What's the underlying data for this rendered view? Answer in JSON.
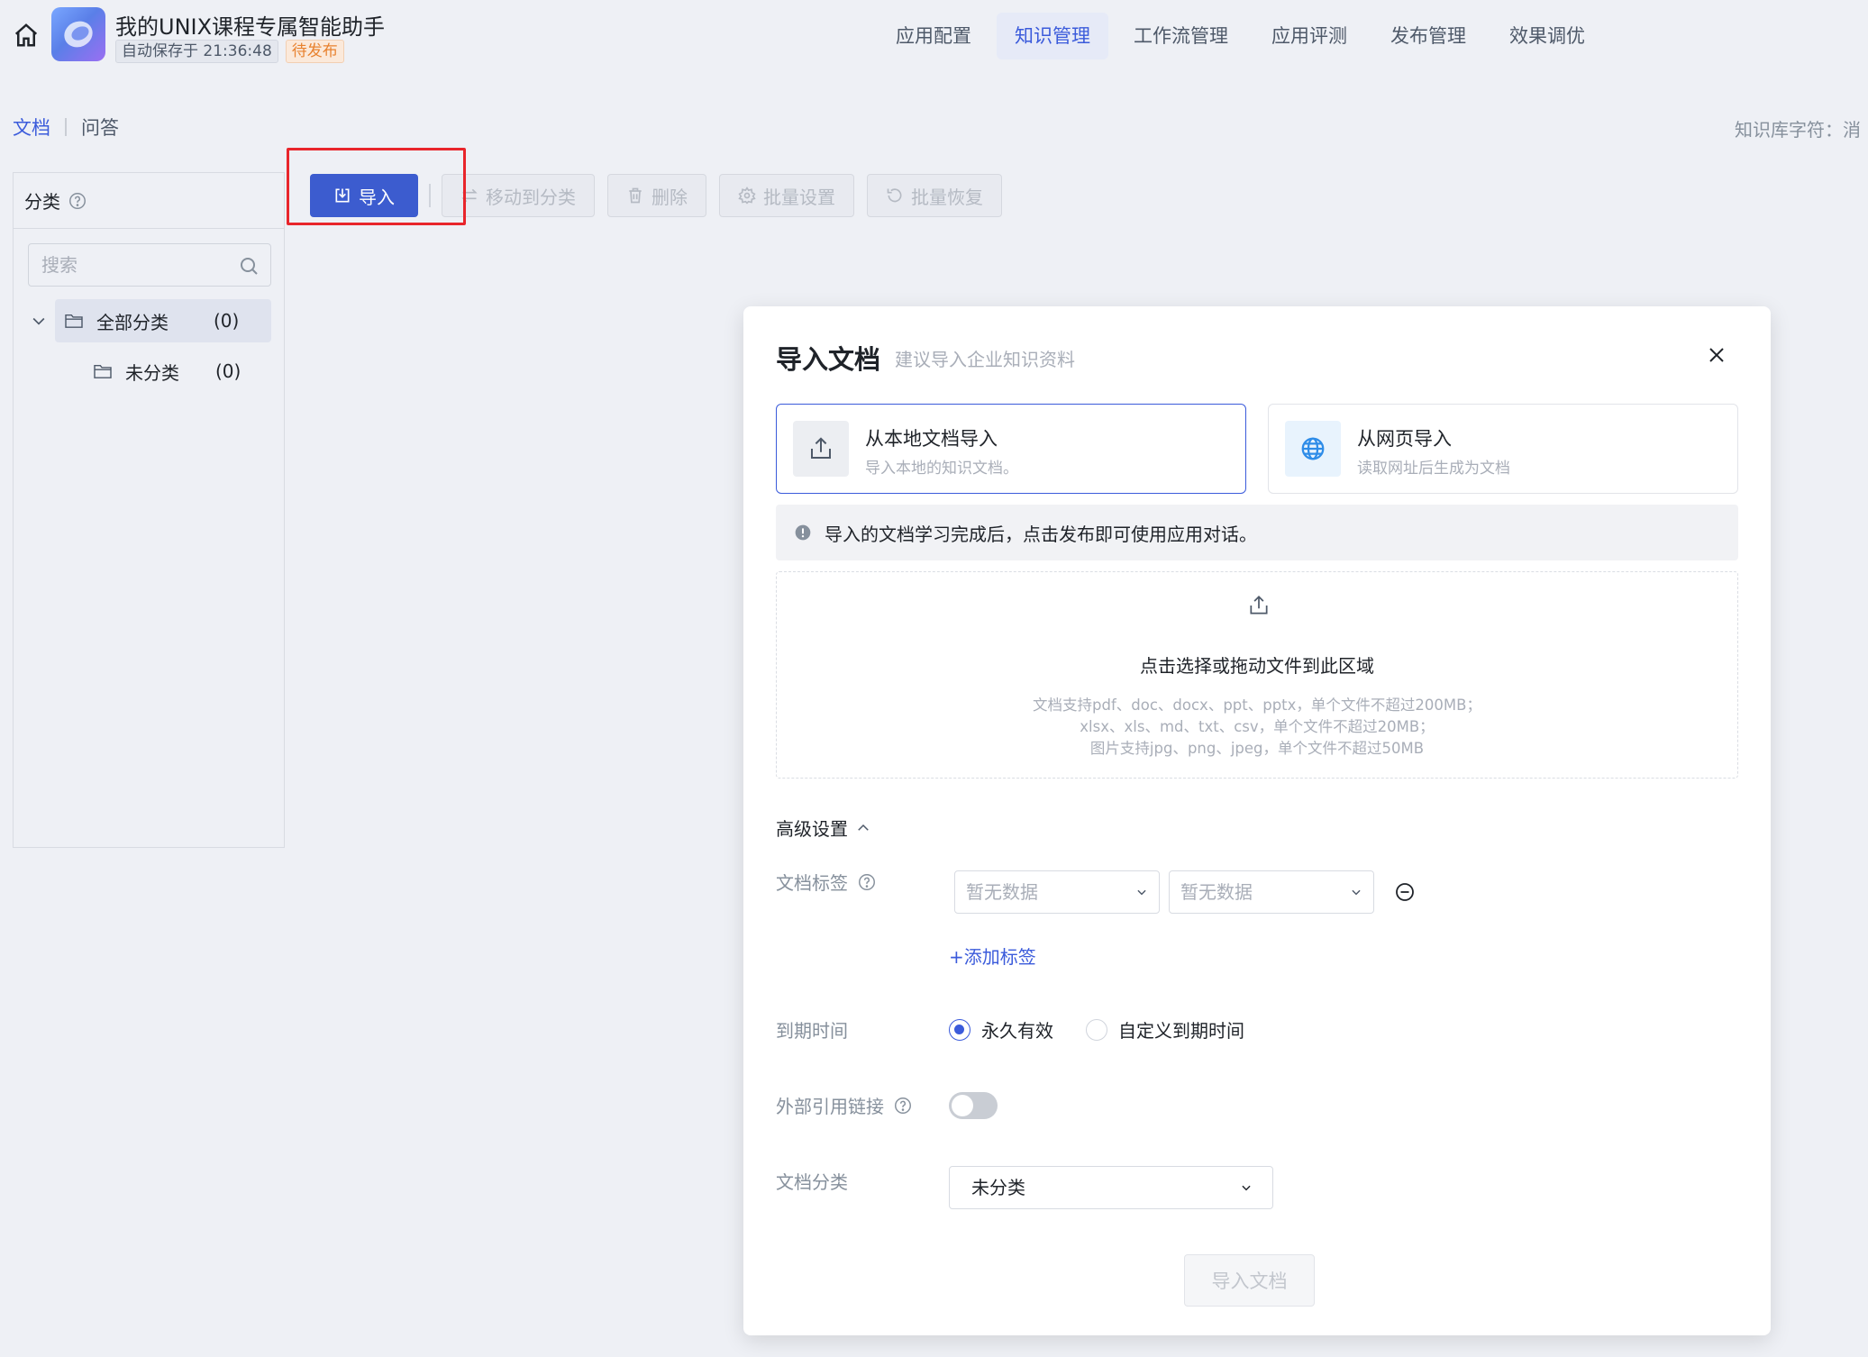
{
  "header": {
    "app_title": "我的UNIX课程专属智能助手",
    "autosave": "自动保存于 21:36:48",
    "status_badge": "待发布",
    "nav": [
      "应用配置",
      "知识管理",
      "工作流管理",
      "应用评测",
      "发布管理",
      "效果调优"
    ],
    "active_nav": "知识管理"
  },
  "subnav": {
    "tab_documents": "文档",
    "tab_qa": "问答",
    "kb_chars": "知识库字符：消"
  },
  "sidebar": {
    "title": "分类",
    "search_placeholder": "搜索",
    "tree": {
      "root_label": "全部分类",
      "root_count": "(0)",
      "child_label": "未分类",
      "child_count": "(0)"
    }
  },
  "toolbar": {
    "import_label": "导入",
    "move_label": "移动到分类",
    "delete_label": "删除",
    "batch_settings_label": "批量设置",
    "batch_restore_label": "批量恢复"
  },
  "modal": {
    "title": "导入文档",
    "subtitle": "建议导入企业知识资料",
    "sources": {
      "local_title": "从本地文档导入",
      "local_desc": "导入本地的知识文档。",
      "web_title": "从网页导入",
      "web_desc": "读取网址后生成为文档"
    },
    "notice": "导入的文档学习完成后，点击发布即可使用应用对话。",
    "dropzone": {
      "title": "点击选择或拖动文件到此区域",
      "line1": "文档支持pdf、doc、docx、ppt、pptx，单个文件不超过200MB；",
      "line2": "xlsx、xls、md、txt、csv，单个文件不超过20MB；",
      "line3": "图片支持jpg、png、jpeg，单个文件不超过50MB"
    },
    "advanced": {
      "toggle_label": "高级设置",
      "tags_label": "文档标签",
      "tag_select_1": "暂无数据",
      "tag_select_2": "暂无数据",
      "add_tag": "+添加标签",
      "expire_label": "到期时间",
      "expire_permanent": "永久有效",
      "expire_custom": "自定义到期时间",
      "expire_selected": "永久有效",
      "ext_link_label": "外部引用链接",
      "ext_link_enabled": false,
      "category_label": "文档分类",
      "category_value": "未分类"
    },
    "submit_label": "导入文档"
  },
  "colors": {
    "primary": "#3c5ccf",
    "highlight": "#e8252b",
    "pending": "#e8822f",
    "background": "#eef0f5"
  }
}
